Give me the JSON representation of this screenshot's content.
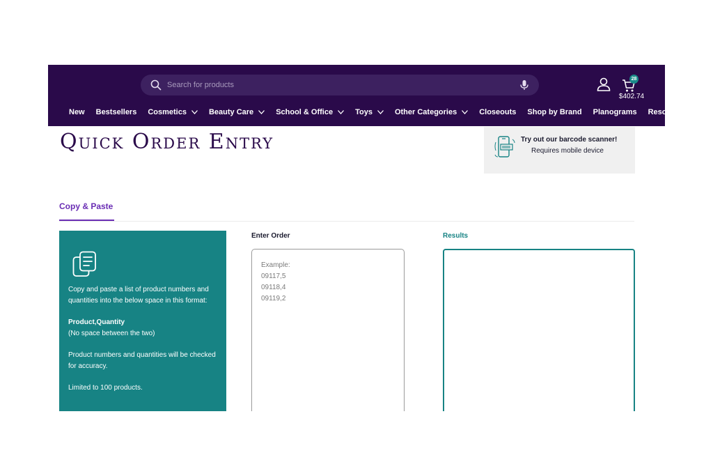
{
  "header": {
    "search": {
      "placeholder": "Search for products"
    },
    "cart": {
      "count": "28",
      "total": "$402.74"
    },
    "nav": [
      {
        "label": "New",
        "has_dropdown": false
      },
      {
        "label": "Bestsellers",
        "has_dropdown": false
      },
      {
        "label": "Cosmetics",
        "has_dropdown": true
      },
      {
        "label": "Beauty Care",
        "has_dropdown": true
      },
      {
        "label": "School & Office",
        "has_dropdown": true
      },
      {
        "label": "Toys",
        "has_dropdown": true
      },
      {
        "label": "Other Categories",
        "has_dropdown": true
      },
      {
        "label": "Closeouts",
        "has_dropdown": false
      },
      {
        "label": "Shop by Brand",
        "has_dropdown": false
      },
      {
        "label": "Planograms",
        "has_dropdown": false
      },
      {
        "label": "Resources",
        "has_dropdown": true
      }
    ]
  },
  "main": {
    "title": "Quick Order Entry",
    "promo": {
      "title": "Try out our barcode scanner!",
      "subtitle": "Requires mobile device"
    },
    "tabs": [
      {
        "label": "Copy & Paste",
        "active": true
      }
    ],
    "info": {
      "p1": "Copy and paste a list of product numbers and quantities into the below space in this format:",
      "p2": "Product,Quantity",
      "p3": "(No space between the two)",
      "p4": "Product numbers and quantities will be checked for accuracy.",
      "p5": "Limited to 100 products."
    },
    "enter_order": {
      "label": "Enter Order",
      "placeholder": "Example:\n09117,5\n09118,4\n09119,2"
    },
    "results": {
      "label": "Results"
    }
  },
  "colors": {
    "header_bg": "#2a0a4a",
    "accent_purple": "#6a2db4",
    "teal": "#178384"
  }
}
